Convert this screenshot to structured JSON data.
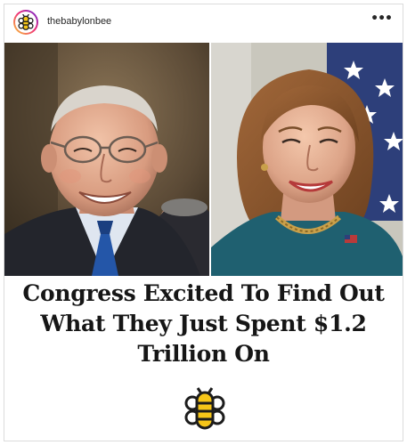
{
  "post": {
    "username": "thebabylonbee",
    "more_icon": "more-horizontal-icon",
    "more_glyph": "•••",
    "avatar_icon": "bee-logo-icon",
    "headline": "Congress Excited To Find Out What They Just Spent $1.2 Trillion On",
    "logo_icon": "bee-logo-icon"
  },
  "colors": {
    "text": "#262626",
    "headline": "#161616",
    "border": "#dbdbdb",
    "logo_yellow": "#f5c518",
    "logo_dark": "#1c1c1c"
  }
}
